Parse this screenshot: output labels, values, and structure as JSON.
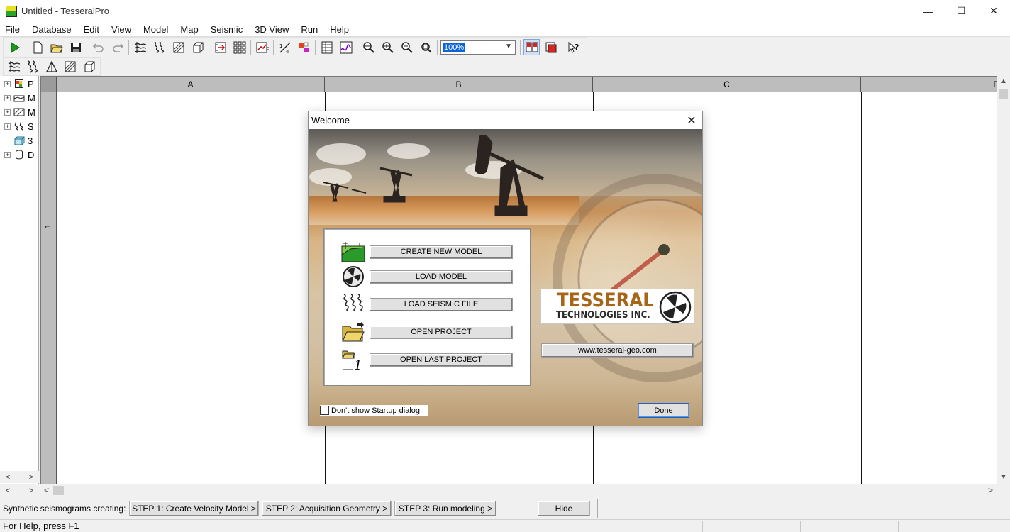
{
  "window": {
    "title": "Untitled - TesseralPro",
    "minimize_glyph": "—",
    "maximize_glyph": "☐",
    "close_glyph": "✕"
  },
  "menubar": [
    "File",
    "Database",
    "Edit",
    "View",
    "Model",
    "Map",
    "Seismic",
    "3D View",
    "Run",
    "Help"
  ],
  "toolbar": {
    "zoom_value": "100%",
    "icons": [
      "run-icon",
      "new-file-icon",
      "open-folder-icon",
      "save-icon",
      "undo-icon",
      "redo-icon",
      "horizons-icon",
      "seismic-traces-icon",
      "polygon-hatch-icon",
      "cube-icon",
      "import-icon",
      "grid-icon",
      "chart-edit-icon",
      "scale-icon",
      "colors-icon",
      "table-icon",
      "spectrum-icon",
      "zoom-out-alt-icon",
      "zoom-in-icon",
      "zoom-out-icon",
      "zoom-fit-icon",
      "split-view-icon",
      "frame-view-icon",
      "context-help-icon"
    ]
  },
  "tree": {
    "items": [
      {
        "label": "P",
        "icon": "project-icon"
      },
      {
        "label": "M",
        "icon": "model-icon"
      },
      {
        "label": "M",
        "icon": "map-icon"
      },
      {
        "label": "S",
        "icon": "seismic-icon"
      },
      {
        "label": "3",
        "icon": "3d-view-icon"
      },
      {
        "label": "D",
        "icon": "database-icon"
      }
    ],
    "scroll_left": "<",
    "scroll_right": ">"
  },
  "grid": {
    "columns": [
      "A",
      "B",
      "C",
      "D"
    ],
    "rows": [
      "1"
    ]
  },
  "dialog": {
    "title": "Welcome",
    "close_glyph": "✕",
    "buttons": [
      {
        "label": "CREATE NEW MODEL",
        "icon": "create-model-icon"
      },
      {
        "label": "LOAD MODEL",
        "icon": "load-model-icon"
      },
      {
        "label": "LOAD SEISMIC FILE",
        "icon": "seismic-file-icon"
      },
      {
        "label": "OPEN PROJECT",
        "icon": "open-project-icon"
      },
      {
        "label": "OPEN LAST PROJECT",
        "icon": "open-last-project-icon"
      }
    ],
    "logo_line1": "TESSERAL",
    "logo_line2": "TECHNOLOGIES INC.",
    "url": "www.tesseral-geo.com",
    "dont_show_label": "Don't show Startup dialog",
    "done_label": "Done"
  },
  "stepbar": {
    "label": "Synthetic seismograms creating:",
    "steps": [
      "STEP 1: Create Velocity Model >",
      "STEP 2: Acquisition Geometry >",
      "STEP 3: Run modeling >"
    ],
    "hide_label": "Hide"
  },
  "statusbar": {
    "text": "For Help, press F1"
  }
}
